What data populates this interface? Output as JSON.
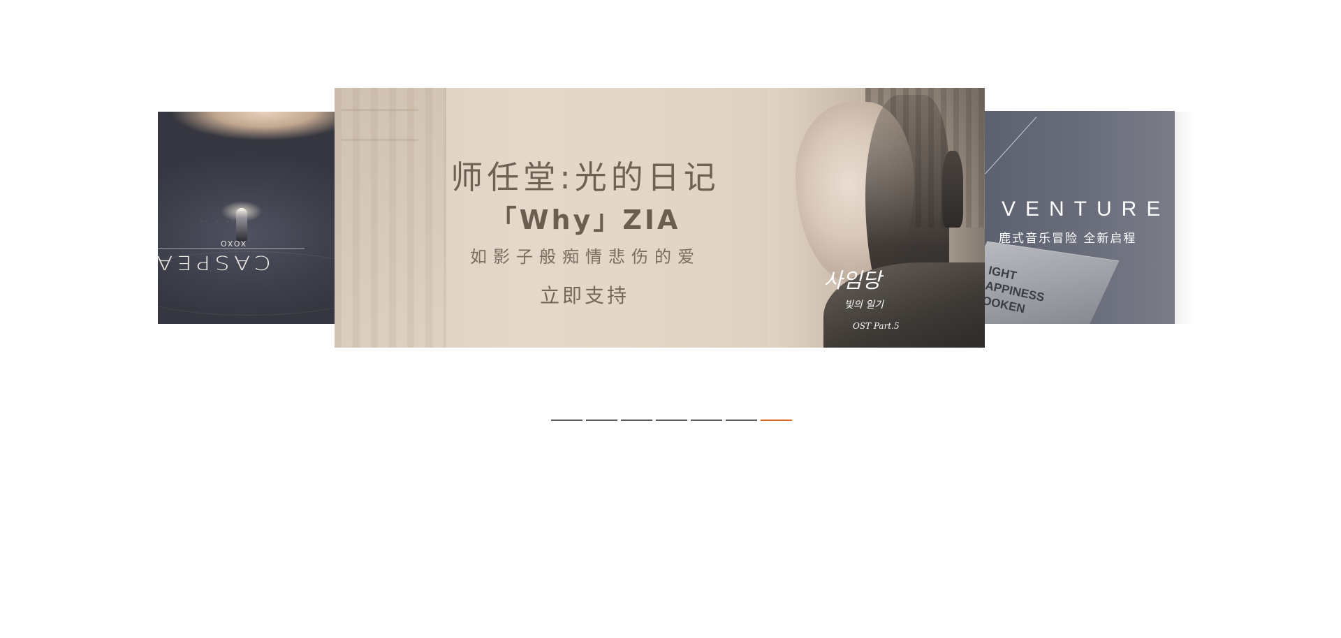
{
  "carousel": {
    "slides": [
      {
        "id": "left",
        "lines": [
          "XOXO",
          "CASPEA"
        ]
      },
      {
        "id": "center",
        "headline": "师任堂:光的日记",
        "song": "「Why」ZIA",
        "tagline": "如影子般痴情悲伤的爱",
        "cta": "立即支持",
        "ost_logo": "사임당",
        "ost_sub": "빛의 일기",
        "ost_part": "OST Part.5"
      },
      {
        "id": "right",
        "title": "VENTURE",
        "subtitle": "鹿式音乐冒险  全新启程",
        "flag_lines": [
          "IGHT",
          "APPINESS",
          "OOKEN"
        ]
      }
    ],
    "pagination": {
      "count": 7,
      "active_index": 6,
      "colors": {
        "inactive": "#5a5a5a",
        "active": "#e06a22"
      }
    }
  }
}
